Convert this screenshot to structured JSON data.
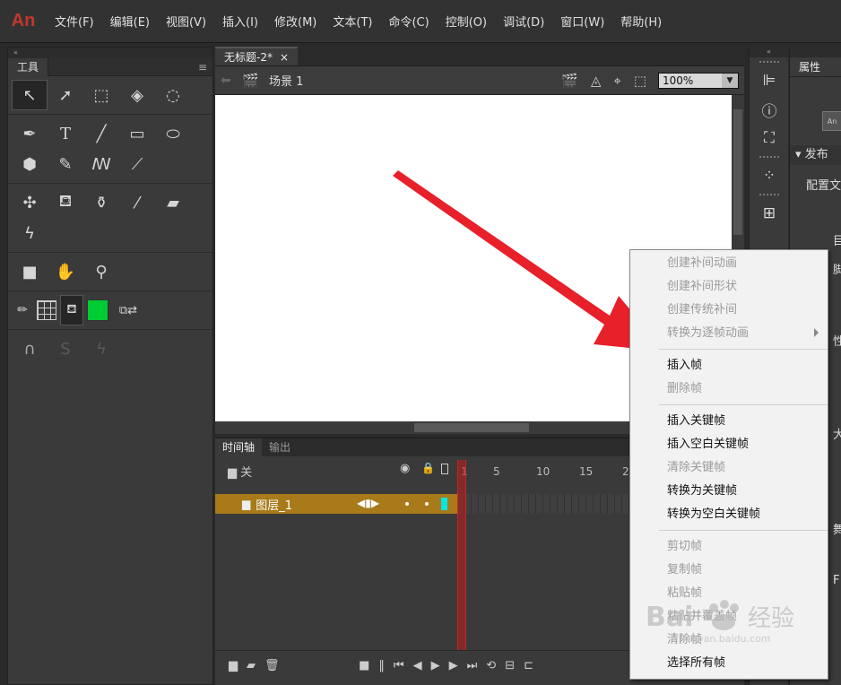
{
  "app": {
    "logo": "An"
  },
  "menubar": [
    "文件(F)",
    "编辑(E)",
    "视图(V)",
    "插入(I)",
    "修改(M)",
    "文本(T)",
    "命令(C)",
    "控制(O)",
    "调试(D)",
    "窗口(W)",
    "帮助(H)"
  ],
  "tools": {
    "title": "工具",
    "menu_icon": "hamburger-icon",
    "colors": {
      "fill": "#00cc33"
    }
  },
  "document": {
    "tab_title": "无标题-2*",
    "tab_close": "×",
    "scene_label": "场景 1",
    "zoom": "100%"
  },
  "timeline": {
    "tabs": [
      "时间轴",
      "输出"
    ],
    "layer_header": "关",
    "layer_name": "图层_1",
    "ruler": [
      "1",
      "5",
      "10",
      "15",
      "2"
    ]
  },
  "properties": {
    "tab": "属性",
    "badge": "An",
    "publish_section": "发布",
    "config_label": "配置文",
    "fragments": [
      "目",
      "脚",
      "性",
      "大",
      "舞",
      "F"
    ]
  },
  "context_menu": {
    "items": [
      {
        "label": "创建补间动画",
        "enabled": false
      },
      {
        "label": "创建补间形状",
        "enabled": false
      },
      {
        "label": "创建传统补间",
        "enabled": false
      },
      {
        "label": "转换为逐帧动画",
        "enabled": false,
        "submenu": true
      },
      {
        "label": "插入帧",
        "enabled": true
      },
      {
        "label": "删除帧",
        "enabled": false
      },
      {
        "label": "插入关键帧",
        "enabled": true
      },
      {
        "label": "插入空白关键帧",
        "enabled": true
      },
      {
        "label": "清除关键帧",
        "enabled": false
      },
      {
        "label": "转换为关键帧",
        "enabled": true
      },
      {
        "label": "转换为空白关键帧",
        "enabled": true
      },
      {
        "label": "剪切帧",
        "enabled": false
      },
      {
        "label": "复制帧",
        "enabled": false
      },
      {
        "label": "粘贴帧",
        "enabled": false
      },
      {
        "label": "粘贴并覆盖帧",
        "enabled": false
      },
      {
        "label": "清除帧",
        "enabled": false
      },
      {
        "label": "选择所有帧",
        "enabled": true
      }
    ]
  },
  "annotation": {
    "arrow_color": "#e8202a"
  },
  "watermark": {
    "text": "Bai 经验",
    "url": "jingyan.baidu.com"
  }
}
